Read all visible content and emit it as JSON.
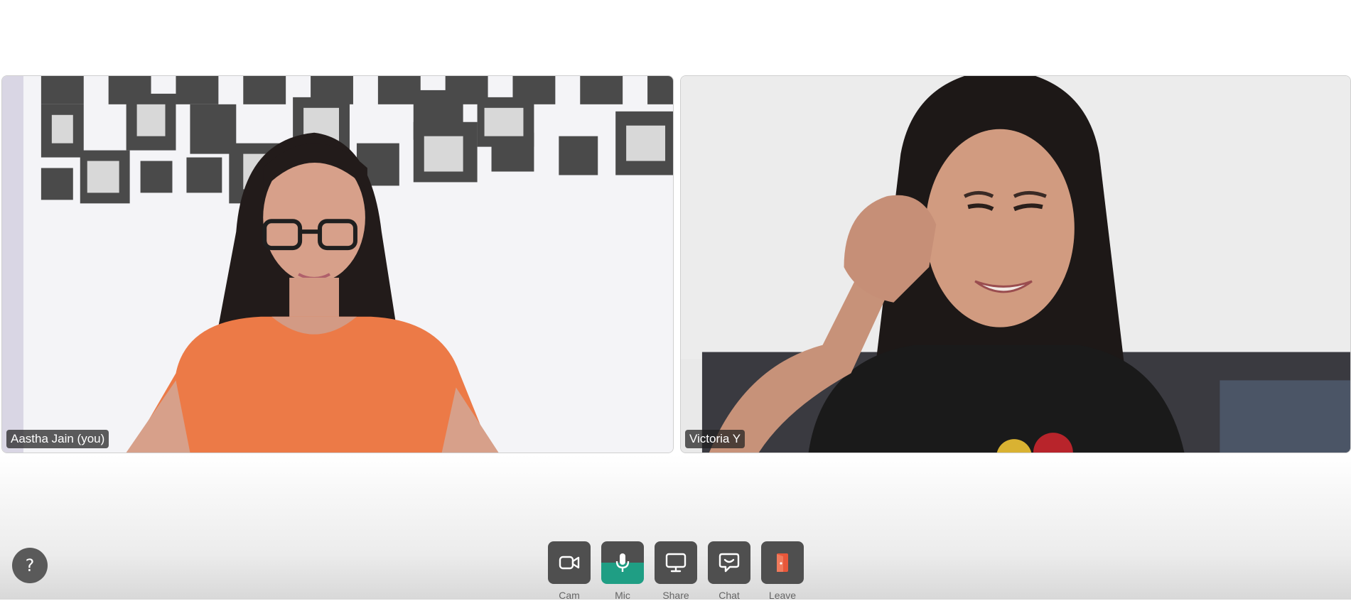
{
  "participants": [
    {
      "name": "Aastha Jain (you)"
    },
    {
      "name": "Victoria Y"
    }
  ],
  "help": {
    "label": "?"
  },
  "controls": {
    "cam": {
      "label": "Cam",
      "icon": "camera-icon"
    },
    "mic": {
      "label": "Mic",
      "icon": "microphone-icon",
      "active_color": "#1f9e84"
    },
    "share": {
      "label": "Share",
      "icon": "screen-share-icon"
    },
    "chat": {
      "label": "Chat",
      "icon": "chat-icon"
    },
    "leave": {
      "label": "Leave",
      "icon": "leave-door-icon",
      "accent_color": "#e8573a"
    }
  }
}
